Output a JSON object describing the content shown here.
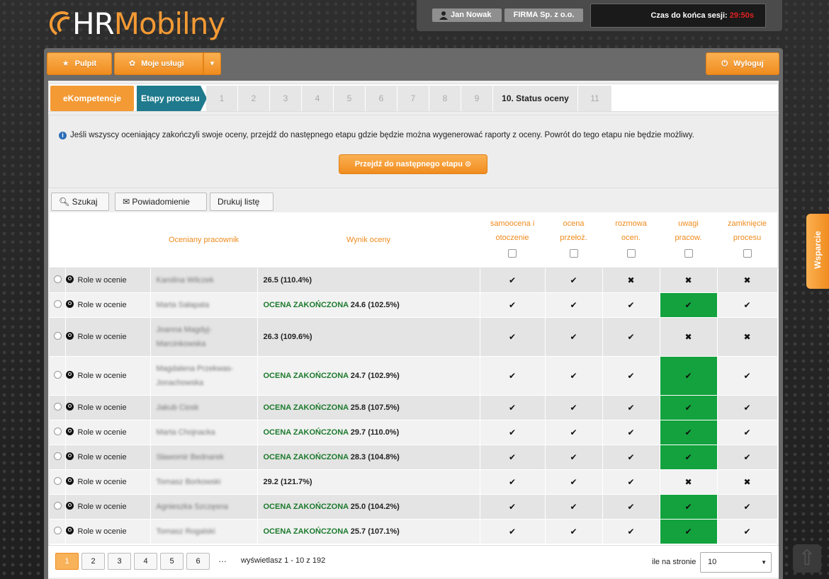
{
  "app": {
    "logo_hr": "HR",
    "logo_mobilny": "Mobilny"
  },
  "user_bar": {
    "user_name": "Jan Nowak",
    "company": "FIRMA Sp. z o.o.",
    "session_label": "Czas do końca sesji:",
    "session_time": "29:50s"
  },
  "nav": {
    "pulpit": "Pulpit",
    "moje_uslugi": "Moje usługi",
    "wyloguj": "Wyloguj"
  },
  "steps": {
    "ekompetencje": "eKompetencje",
    "etapy": "Etapy procesu",
    "items": [
      "1",
      "2",
      "3",
      "4",
      "5",
      "6",
      "7",
      "8",
      "9",
      "10. Status oceny",
      "11"
    ]
  },
  "info": {
    "text": "Jeśli wszyscy oceniający zakończyli swoje oceny, przejdź do następnego etapu gdzie będzie można wygenerować raporty z oceny. Powrót do tego etapu nie będzie możliwy.",
    "next_button": "Przejdź do następnego etapu"
  },
  "toolbar": {
    "search": "Szukaj",
    "notify": "Powiadomienie",
    "print": "Drukuj listę"
  },
  "table": {
    "headers": {
      "employee": "Oceniany pracownik",
      "result": "Wynik oceny",
      "c1a": "samoocena i",
      "c1b": "otoczenie",
      "c2a": "ocena",
      "c2b": "przełoż.",
      "c3a": "rozmowa",
      "c3b": "ocen.",
      "c4a": "uwagi",
      "c4b": "pracow.",
      "c5a": "zamknięcie",
      "c5b": "procesu"
    },
    "rows": [
      {
        "role": "Role w ocenie",
        "name": "Karolina Wilczek",
        "status": "",
        "score": "26.5 (110.4%)",
        "c": [
          "✔",
          "✔",
          "✖",
          "✖",
          "✖"
        ],
        "green": false
      },
      {
        "role": "Role w ocenie",
        "name": "Marta Sałapata",
        "status": "OCENA ZAKOŃCZONA",
        "score": "24.6 (102.5%)",
        "c": [
          "✔",
          "✔",
          "✔",
          "✔",
          "✔"
        ],
        "green": true
      },
      {
        "role": "Role w ocenie",
        "name": "Joanna Magdyj-Marcinkowska",
        "status": "",
        "score": "26.3 (109.6%)",
        "c": [
          "✔",
          "✔",
          "✔",
          "✖",
          "✖"
        ],
        "green": false
      },
      {
        "role": "Role w ocenie",
        "name": "Magdalena Przekwas-Jonachowska",
        "status": "OCENA ZAKOŃCZONA",
        "score": "24.7 (102.9%)",
        "c": [
          "✔",
          "✔",
          "✔",
          "✔",
          "✔"
        ],
        "green": true
      },
      {
        "role": "Role w ocenie",
        "name": "Jakub Ciosk",
        "status": "OCENA ZAKOŃCZONA",
        "score": "25.8 (107.5%)",
        "c": [
          "✔",
          "✔",
          "✔",
          "✔",
          "✔"
        ],
        "green": true
      },
      {
        "role": "Role w ocenie",
        "name": "Marta Chojnacka",
        "status": "OCENA ZAKOŃCZONA",
        "score": "29.7 (110.0%)",
        "c": [
          "✔",
          "✔",
          "✔",
          "✔",
          "✔"
        ],
        "green": true
      },
      {
        "role": "Role w ocenie",
        "name": "Sławomir Bednarek",
        "status": "OCENA ZAKOŃCZONA",
        "score": "28.3 (104.8%)",
        "c": [
          "✔",
          "✔",
          "✔",
          "✔",
          "✔"
        ],
        "green": true
      },
      {
        "role": "Role w ocenie",
        "name": "Tomasz Borkowski",
        "status": "",
        "score": "29.2 (121.7%)",
        "c": [
          "✔",
          "✔",
          "✔",
          "✖",
          "✖"
        ],
        "green": false
      },
      {
        "role": "Role w ocenie",
        "name": "Agnieszka Szczęsna",
        "status": "OCENA ZAKOŃCZONA",
        "score": "25.0 (104.2%)",
        "c": [
          "✔",
          "✔",
          "✔",
          "✔",
          "✔"
        ],
        "green": true
      },
      {
        "role": "Role w ocenie",
        "name": "Tomasz Rogalski",
        "status": "OCENA ZAKOŃCZONA",
        "score": "25.7 (107.1%)",
        "c": [
          "✔",
          "✔",
          "✔",
          "✔",
          "✔"
        ],
        "green": true
      }
    ]
  },
  "pagination": {
    "pages": [
      "1",
      "2",
      "3",
      "4",
      "5",
      "6"
    ],
    "dots": "…",
    "info": "wyświetlasz 1 - 10 z 192",
    "per_page_label": "ile na stronie",
    "per_page_value": "10"
  },
  "support": "Wsparcie",
  "colors": {
    "accent": "#f39a34",
    "teal": "#1e7a8c",
    "green": "#13a23e",
    "session_red": "#e32020"
  }
}
